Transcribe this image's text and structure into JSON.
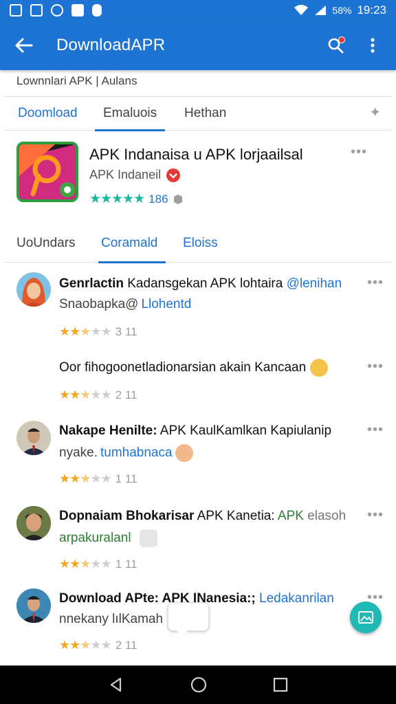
{
  "status_bar": {
    "battery": "58%",
    "time": "19:23"
  },
  "app_bar": {
    "title": "DownloadAPR"
  },
  "breadcrumb": "Lownnlari APK | Aulans",
  "tabs_top": [
    {
      "label": "Doomload",
      "active": false
    },
    {
      "label": "Emaluois",
      "active": true
    },
    {
      "label": "Hethan",
      "active": false
    }
  ],
  "app": {
    "name": "APK Indanaisa u APK lorjaailsal",
    "developer": "APK Indaneil",
    "rating_count": "186"
  },
  "tabs_second": [
    {
      "label": "UoUndars",
      "active": false
    },
    {
      "label": "Coramald",
      "active": true
    },
    {
      "label": "Eloiss",
      "active": false
    }
  ],
  "reviews": [
    {
      "title_bold": "Genrlactin",
      "title_rest": " Kadansgekan APK lohtaira ",
      "title_link": "@lenihan",
      "sub_text": "Snaobapka@",
      "sub_link": "Llohentd",
      "rating": 2.5,
      "count": "3 11"
    },
    {
      "title_bold": "",
      "title_rest": "Oor fihogoonetladionarsian akain Kancaan",
      "sub_text": "",
      "sub_link": "",
      "rating": 2.5,
      "count": "2 11"
    },
    {
      "title_bold": "Nakape Henilte:",
      "title_rest": " APK KaulKamlkan Kapiulanip",
      "sub_text": "nyake.",
      "sub_link": "tumhabnaca",
      "rating": 2.5,
      "count": "1 11"
    },
    {
      "title_bold": "Dopnaiam Bhokarisar",
      "title_rest": " APK Kanetia: ",
      "title_green": "APK",
      "title_grey": " elasoh",
      "sub_text": "arpakuralanl",
      "sub_link": "",
      "rating": 2.5,
      "count": "1 11"
    },
    {
      "title_bold": "Download APte: APK INanesia:;",
      "title_rest": " ",
      "title_link": "Ledakanrilan",
      "sub_text": "nnekany lılKamah",
      "sub_link": "",
      "rating": 2.5,
      "count": "2 11"
    }
  ],
  "colors": {
    "primary": "#1e74d2",
    "star": "#f5a623",
    "teal": "#18b7a3",
    "fab": "#1fb8b3"
  },
  "icons": [
    "back-arrow-icon",
    "search-icon",
    "more-vert-icon",
    "pin-icon",
    "verified-icon",
    "image-icon",
    "nav-back-icon",
    "nav-home-icon",
    "nav-recents-icon"
  ]
}
